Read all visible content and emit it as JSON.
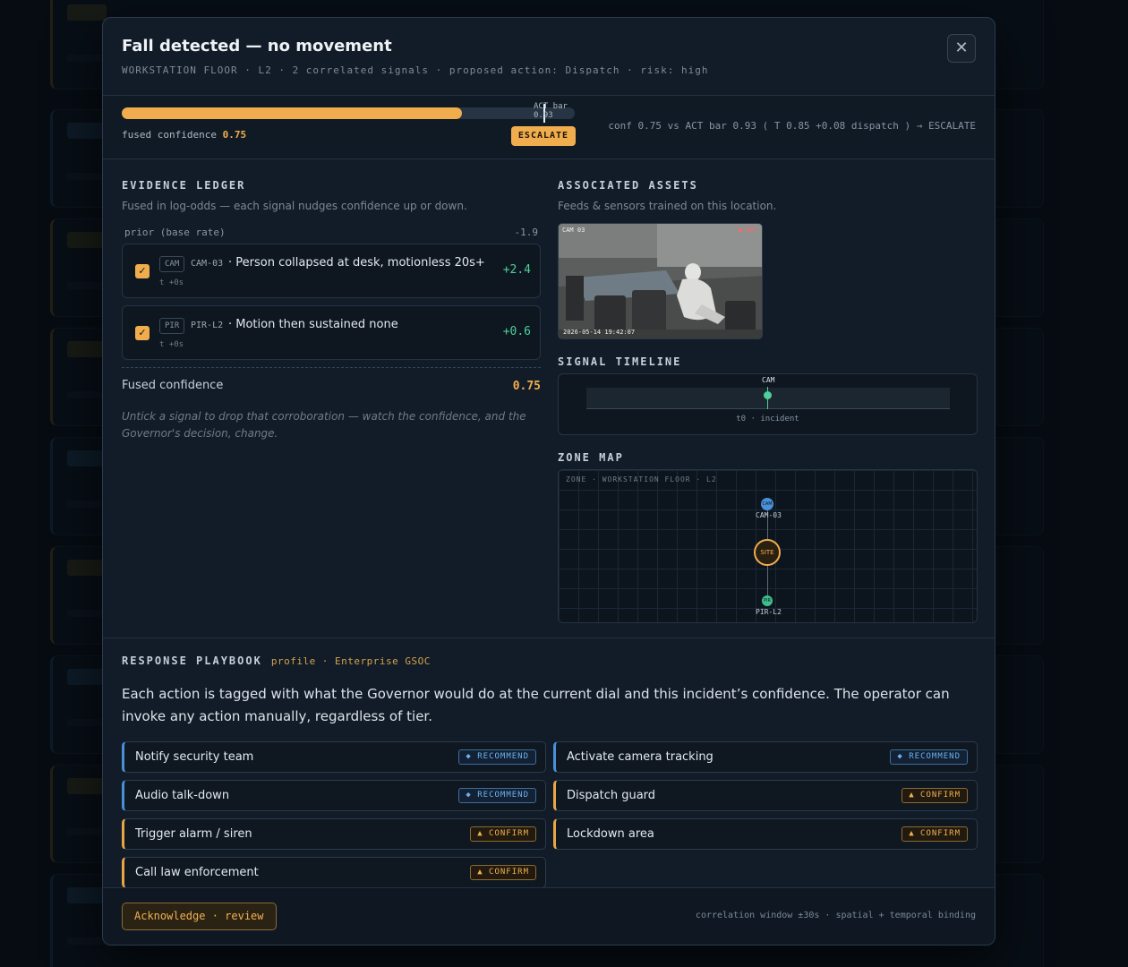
{
  "modal": {
    "title": "Fall detected — no movement",
    "subtitle": "WORKSTATION FLOOR · L2 · 2 correlated signals · proposed action: Dispatch · risk: high",
    "close_glyph": "✕"
  },
  "confidence": {
    "fused": 0.75,
    "act_bar": 0.93,
    "act_bar_label": "ACT bar 0.93",
    "fused_label": "fused confidence",
    "fused_value": "0.75",
    "decision_badge": "ESCALATE",
    "decision_text": "conf 0.75 vs ACT bar 0.93 ( T 0.85 +0.08 dispatch ) → ESCALATE"
  },
  "ledger": {
    "title": "EVIDENCE LEDGER",
    "description": "Fused in log-odds — each signal nudges confidence up or down.",
    "prior_label": "prior (base rate)",
    "prior_value": "-1.9",
    "signals": [
      {
        "tag": "CAM",
        "source": "CAM-03",
        "description": "· Person collapsed at desk, motionless 20s+",
        "time": "t +0s",
        "delta": "+2.4",
        "checked": true
      },
      {
        "tag": "PIR",
        "source": "PIR-L2",
        "description": "· Motion then sustained none",
        "time": "t +0s",
        "delta": "+0.6",
        "checked": true
      }
    ],
    "fused_label": "Fused confidence",
    "fused_value": "0.75",
    "note": "Untick a signal to drop that corroboration — watch the confidence, and the Governor's decision, change."
  },
  "assets": {
    "title": "ASSOCIATED ASSETS",
    "description": "Feeds & sensors trained on this location.",
    "feed_overlay": "CAM 03",
    "feed_rec": "● REC",
    "feed_timestamp": "2026-05-14 19:42:07"
  },
  "timeline": {
    "title": "SIGNAL TIMELINE",
    "marker_label": "CAM",
    "caption": "t0 · incident"
  },
  "zone_map": {
    "title": "ZONE MAP",
    "label": "ZONE · WORKSTATION FLOOR · L2",
    "camera_label": "CAM-03",
    "camera_icon_text": "CAM",
    "site_label": "SITE",
    "pir_label": "PIR-L2",
    "pir_icon_text": "PIR"
  },
  "playbook": {
    "title": "RESPONSE PLAYBOOK",
    "profile": "profile · Enterprise GSOC",
    "description": "Each action is tagged with what the Governor would do at the current dial and this incident’s confidence. The operator can invoke any action manually, regardless of tier.",
    "actions": [
      {
        "label": "Notify security team",
        "badge": "◆ RECOMMEND",
        "tier": "recommend"
      },
      {
        "label": "Activate camera tracking",
        "badge": "◆ RECOMMEND",
        "tier": "recommend"
      },
      {
        "label": "Audio talk-down",
        "badge": "◆ RECOMMEND",
        "tier": "recommend"
      },
      {
        "label": "Dispatch guard",
        "badge": "▲ CONFIRM",
        "tier": "confirm"
      },
      {
        "label": "Trigger alarm / siren",
        "badge": "▲ CONFIRM",
        "tier": "confirm"
      },
      {
        "label": "Lockdown area",
        "badge": "▲ CONFIRM",
        "tier": "confirm"
      },
      {
        "label": "Call law enforcement",
        "badge": "▲ CONFIRM",
        "tier": "confirm"
      }
    ]
  },
  "footer": {
    "ack_label": "Acknowledge · review",
    "note": "correlation window ±30s · spatial + temporal binding"
  },
  "colors": {
    "accent": "#f0ad4e",
    "positive": "#4fcf9a",
    "recommend": "#4a90d9"
  }
}
